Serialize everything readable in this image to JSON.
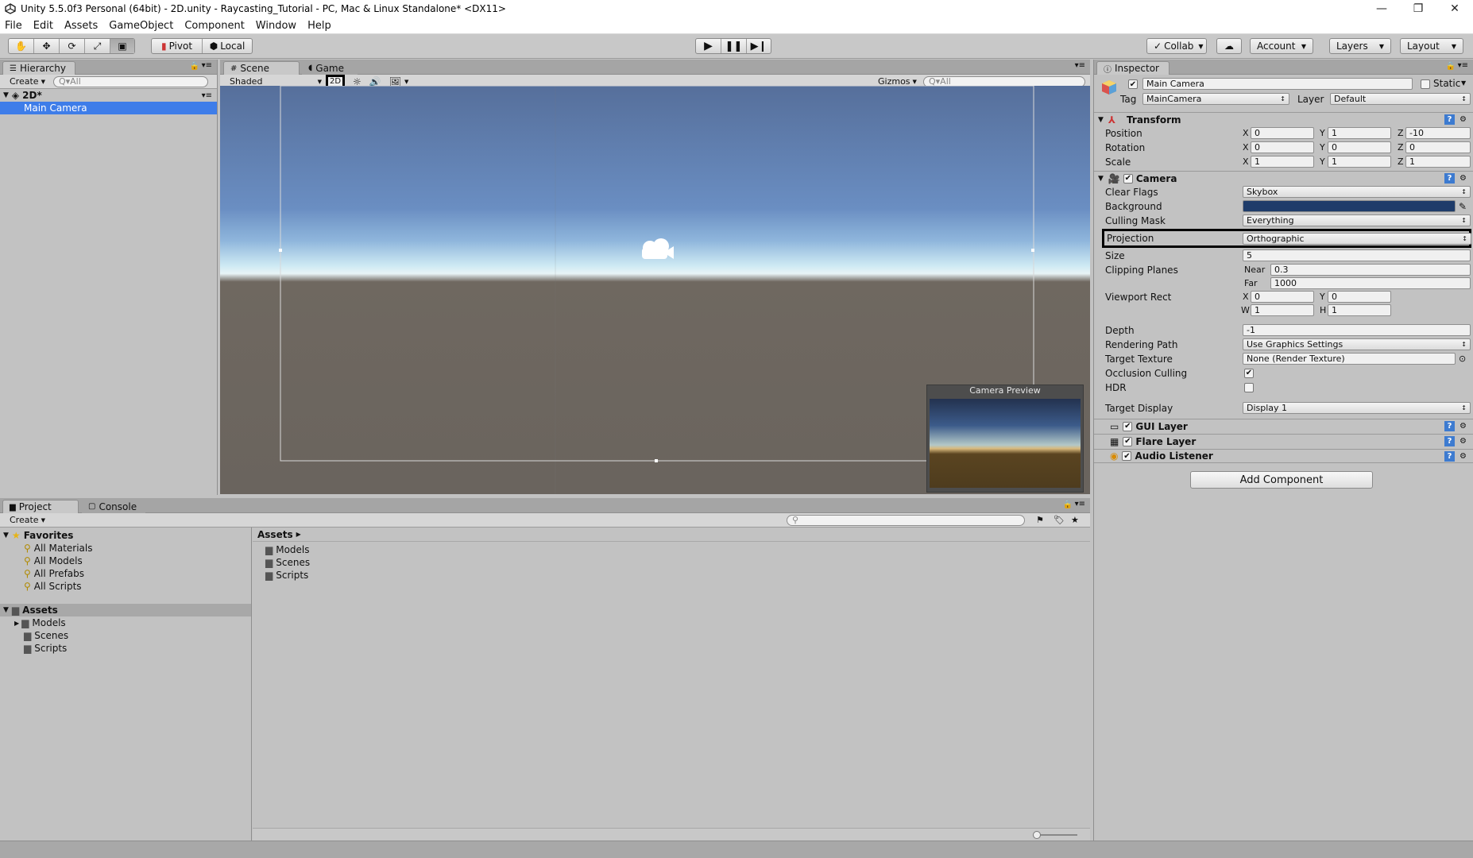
{
  "window": {
    "title": "Unity 5.5.0f3 Personal (64bit) - 2D.unity - Raycasting_Tutorial - PC, Mac & Linux Standalone* <DX11>",
    "minimize": "—",
    "restore": "❐",
    "close": "✕"
  },
  "menu": [
    "File",
    "Edit",
    "Assets",
    "GameObject",
    "Component",
    "Window",
    "Help"
  ],
  "toolbar": {
    "pivot": "Pivot",
    "local": "Local",
    "collab": "Collab",
    "account": "Account",
    "layers": "Layers",
    "layout": "Layout"
  },
  "hierarchy": {
    "tab": "Hierarchy",
    "create": "Create",
    "search_placeholder": "Q▾All",
    "scene": "2D*",
    "items": [
      "Main Camera"
    ]
  },
  "scene": {
    "tab_scene": "Scene",
    "tab_game": "Game",
    "shading": "Shaded",
    "mode_2d": "2D",
    "gizmos": "Gizmos",
    "search_placeholder": "Q▾All",
    "camera_preview": "Camera Preview"
  },
  "project": {
    "tab_project": "Project",
    "tab_console": "Console",
    "create": "Create",
    "favorites_label": "Favorites",
    "favorites": [
      "All Materials",
      "All Models",
      "All Prefabs",
      "All Scripts"
    ],
    "assets_label": "Assets",
    "asset_folders": [
      "Models",
      "Scenes",
      "Scripts"
    ],
    "breadcrumb": "Assets",
    "content": [
      "Models",
      "Scenes",
      "Scripts"
    ]
  },
  "inspector": {
    "tab": "Inspector",
    "object_name": "Main Camera",
    "static_label": "Static",
    "tag_label": "Tag",
    "tag_value": "MainCamera",
    "layer_label": "Layer",
    "layer_value": "Default",
    "transform": {
      "title": "Transform",
      "position_label": "Position",
      "rotation_label": "Rotation",
      "scale_label": "Scale",
      "position": [
        "0",
        "1",
        "-10"
      ],
      "rotation": [
        "0",
        "0",
        "0"
      ],
      "scale": [
        "1",
        "1",
        "1"
      ]
    },
    "axis": [
      "X",
      "Y",
      "Z"
    ],
    "camera": {
      "title": "Camera",
      "clear_flags_label": "Clear Flags",
      "clear_flags": "Skybox",
      "background_label": "Background",
      "background_color": "#1f3c6a",
      "culling_mask_label": "Culling Mask",
      "culling_mask": "Everything",
      "projection_label": "Projection",
      "projection": "Orthographic",
      "size_label": "Size",
      "size": "5",
      "clipping_label": "Clipping Planes",
      "near_label": "Near",
      "near": "0.3",
      "far_label": "Far",
      "far": "1000",
      "viewport_label": "Viewport Rect",
      "vp_x": "0",
      "vp_y": "0",
      "vp_w": "1",
      "vp_h": "1",
      "vp_x_label": "X",
      "vp_y_label": "Y",
      "vp_w_label": "W",
      "vp_h_label": "H",
      "depth_label": "Depth",
      "depth": "-1",
      "rendering_path_label": "Rendering Path",
      "rendering_path": "Use Graphics Settings",
      "target_texture_label": "Target Texture",
      "target_texture": "None (Render Texture)",
      "occlusion_label": "Occlusion Culling",
      "hdr_label": "HDR",
      "target_display_label": "Target Display",
      "target_display": "Display 1"
    },
    "components": [
      "GUI Layer",
      "Flare Layer",
      "Audio Listener"
    ],
    "add_component": "Add Component"
  }
}
